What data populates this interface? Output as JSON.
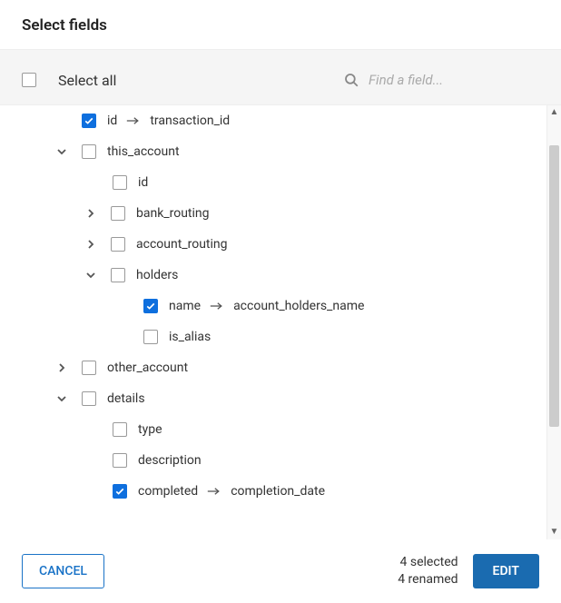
{
  "header": {
    "title": "Select fields"
  },
  "select_all": {
    "label": "Select all",
    "checked": false
  },
  "search": {
    "placeholder": "Find a field..."
  },
  "tree": {
    "id": {
      "label": "id",
      "checked": true,
      "renamed_to": "transaction_id"
    },
    "this_account": {
      "label": "this_account",
      "checked": false,
      "expanded": true,
      "children": {
        "id": {
          "label": "id",
          "checked": false
        },
        "bank_routing": {
          "label": "bank_routing",
          "checked": false,
          "has_children": true,
          "expanded": false
        },
        "account_routing": {
          "label": "account_routing",
          "checked": false,
          "has_children": true,
          "expanded": false
        },
        "holders": {
          "label": "holders",
          "checked": false,
          "expanded": true,
          "children": {
            "name": {
              "label": "name",
              "checked": true,
              "renamed_to": "account_holders_name"
            },
            "is_alias": {
              "label": "is_alias",
              "checked": false
            }
          }
        }
      }
    },
    "other_account": {
      "label": "other_account",
      "checked": false,
      "has_children": true,
      "expanded": false
    },
    "details": {
      "label": "details",
      "checked": false,
      "expanded": true,
      "children": {
        "type": {
          "label": "type",
          "checked": false
        },
        "description": {
          "label": "description",
          "checked": false
        },
        "completed": {
          "label": "completed",
          "checked": true,
          "renamed_to": "completion_date"
        }
      }
    }
  },
  "footer": {
    "cancel": "CANCEL",
    "edit": "EDIT",
    "selected_text": "4 selected",
    "renamed_text": "4 renamed"
  }
}
